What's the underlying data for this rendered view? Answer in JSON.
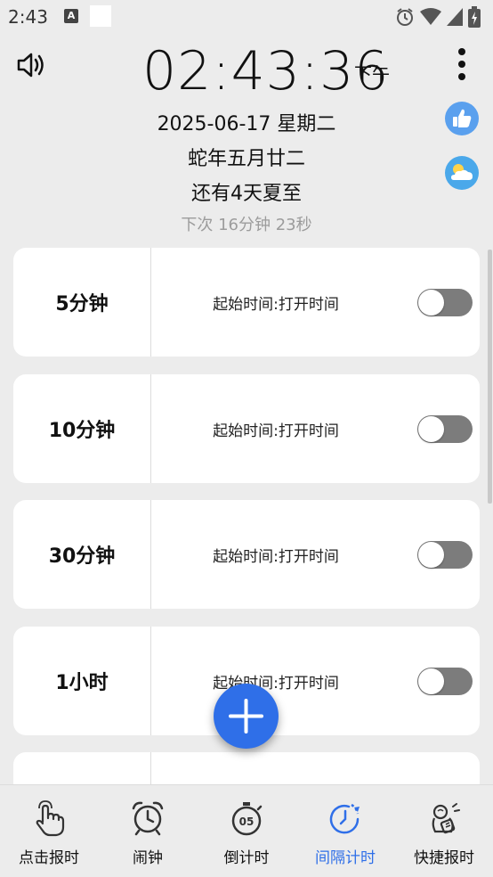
{
  "status_bar": {
    "time": "2:43",
    "notification_icon": "A",
    "icons": [
      "alarm-icon",
      "wifi-icon",
      "signal-icon",
      "battery-icon"
    ]
  },
  "header": {
    "clock": "02:43:36",
    "ampm": "下午",
    "date": "2025-06-17 星期二",
    "lunar": "蛇年五月廿二",
    "solar_term": "还有4天夏至",
    "next_chime": "下次  16分钟 23秒"
  },
  "intervals": [
    {
      "label": "5分钟",
      "start_text": "起始时间:打开时间",
      "enabled": false
    },
    {
      "label": "10分钟",
      "start_text": "起始时间:打开时间",
      "enabled": false
    },
    {
      "label": "30分钟",
      "start_text": "起始时间:打开时间",
      "enabled": false
    },
    {
      "label": "1小时",
      "start_text": "起始时间:打开时间",
      "enabled": false
    },
    {
      "label": "",
      "start_text": "",
      "enabled": false
    }
  ],
  "nav": [
    {
      "label": "点击报时",
      "icon": "tap-icon",
      "active": false
    },
    {
      "label": "闹钟",
      "icon": "alarm-clock-icon",
      "active": false
    },
    {
      "label": "倒计时",
      "icon": "stopwatch-icon",
      "active": false
    },
    {
      "label": "间隔计时",
      "icon": "interval-clock-icon",
      "active": true
    },
    {
      "label": "快捷报时",
      "icon": "quick-chime-icon",
      "active": false
    }
  ],
  "colors": {
    "accent": "#2f6fe8",
    "background": "#ececec",
    "toggle_off": "#7c7c7c"
  }
}
